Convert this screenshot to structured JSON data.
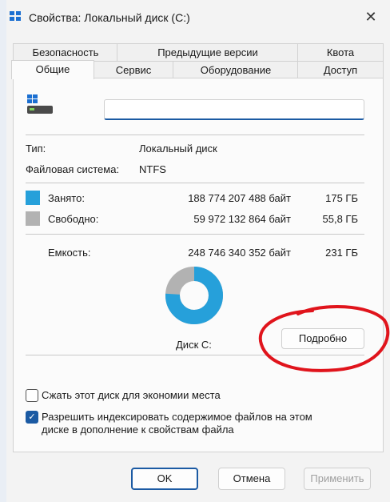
{
  "window": {
    "title": "Свойства: Локальный диск (C:)",
    "close_glyph": "✕"
  },
  "tabs": {
    "row1": [
      "Безопасность",
      "Предыдущие версии",
      "Квота"
    ],
    "row2": [
      "Общие",
      "Сервис",
      "Оборудование",
      "Доступ"
    ],
    "active": "Общие"
  },
  "general": {
    "name_value": "",
    "type_label": "Тип:",
    "type_value": "Локальный диск",
    "fs_label": "Файловая система:",
    "fs_value": "NTFS",
    "used": {
      "label": "Занято:",
      "bytes": "188 774 207 488 байт",
      "size": "175 ГБ",
      "color": "#26a0da"
    },
    "free": {
      "label": "Свободно:",
      "bytes": "59 972 132 864 байт",
      "size": "55,8 ГБ",
      "color": "#b2b2b2"
    },
    "capacity": {
      "label": "Емкость:",
      "bytes": "248 746 340 352 байт",
      "size": "231 ГБ"
    },
    "used_fraction": 0.759,
    "disk_label": "Диск C:",
    "details_button": "Подробно",
    "compress_label": "Сжать этот диск для экономии места",
    "compress_checked": false,
    "index_label_line1": "Разрешить индексировать содержимое файлов на этом",
    "index_label_line2": "диске в дополнение к свойствам файла",
    "index_checked": true
  },
  "footer": {
    "ok": "OK",
    "cancel": "Отмена",
    "apply": "Применить"
  },
  "annotation_color": "#e0141c"
}
